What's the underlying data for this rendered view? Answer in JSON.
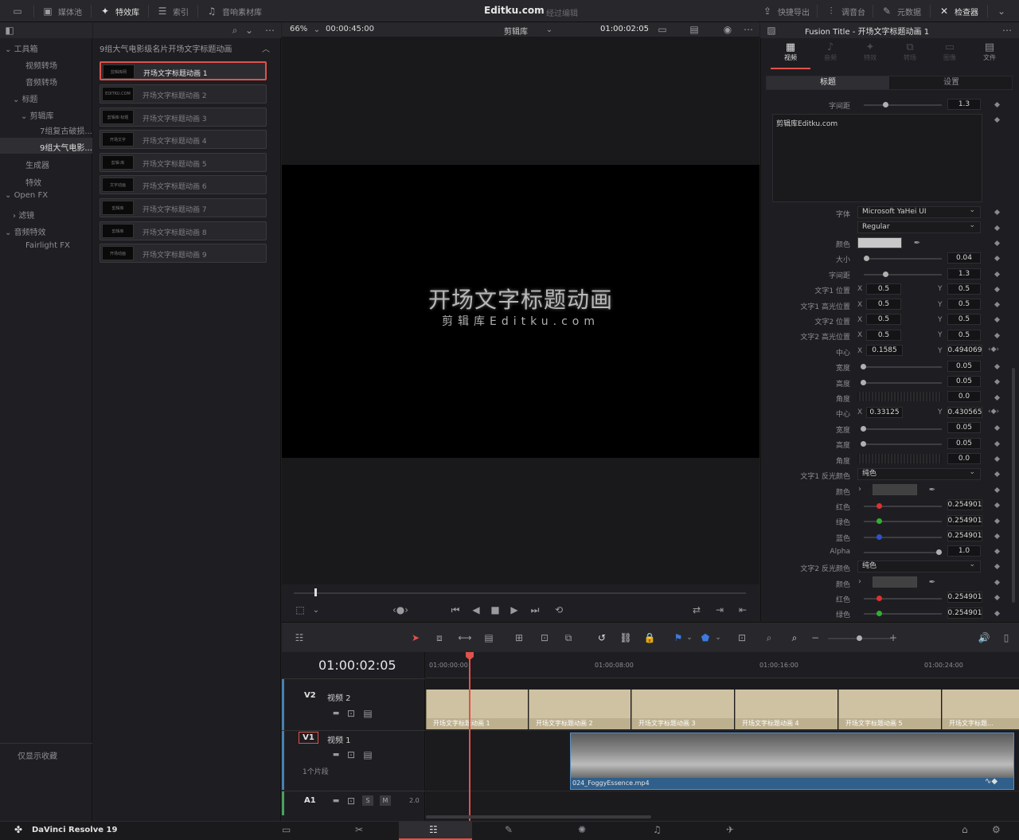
{
  "topbar": {
    "media_pool": "媒体池",
    "effects": "特效库",
    "index": "索引",
    "sound_library": "音响素材库",
    "app_title": "Editku.com",
    "app_sub": "经过编辑",
    "quick_export": "快捷导出",
    "mixer": "调音台",
    "metadata": "元数据",
    "inspector": "检查器"
  },
  "toolbox": {
    "items": [
      "工具箱",
      "视频转场",
      "音频转场",
      "标题",
      "剪辑库",
      "7组复古破损...",
      "9组大气电影...",
      "生成器",
      "特效",
      "Open FX",
      "滤镜",
      "音频特效",
      "Fairlight FX"
    ],
    "favorites": "仅显示收藏"
  },
  "library": {
    "header": "9组大气电影级名片开场文字标题动画",
    "cards": [
      "开场文字标题动画 1",
      "开场文字标题动画 2",
      "开场文字标题动画 3",
      "开场文字标题动画 4",
      "开场文字标题动画 5",
      "开场文字标题动画 6",
      "开场文字标题动画 7",
      "开场文字标题动画 8",
      "开场文字标题动画 9"
    ],
    "thumbs": [
      "剪辑库网",
      "EDITKU.COM",
      "剪辑库·标题",
      "开场文字",
      "剪辑·库",
      "文字动画",
      "剪辑库",
      "剪辑库",
      "开场动画"
    ]
  },
  "viewer": {
    "zoom": "66%",
    "duration": "00:00:45:00",
    "clip_name": "剪辑库",
    "timecode": "01:00:02:05",
    "title_main": "开场文字标题动画",
    "title_sub": "剪辑库Editku.com"
  },
  "inspector": {
    "title": "Fusion Title - 开场文字标题动画 1",
    "tabs": [
      "视频",
      "音频",
      "特效",
      "转场",
      "图像",
      "文件"
    ],
    "subtabs": [
      "标题",
      "设置"
    ],
    "text_content": "剪辑库Editku.com",
    "rows": [
      {
        "label": "字间距",
        "value": "1.3"
      },
      {
        "label": "字体",
        "value": "Microsoft YaHei UI"
      },
      {
        "label": "",
        "value": "Regular"
      },
      {
        "label": "颜色"
      },
      {
        "label": "大小",
        "value": "0.04"
      },
      {
        "label": "字间距",
        "value": "1.3"
      },
      {
        "label": "文字1 位置",
        "x": "0.5",
        "y": "0.5"
      },
      {
        "label": "文字1 高光位置",
        "x": "0.5",
        "y": "0.5"
      },
      {
        "label": "文字2 位置",
        "x": "0.5",
        "y": "0.5"
      },
      {
        "label": "文字2 高光位置",
        "x": "0.5",
        "y": "0.5"
      },
      {
        "label": "中心",
        "x": "0.1585",
        "y": "0.494069"
      },
      {
        "label": "宽度",
        "value": "0.05"
      },
      {
        "label": "高度",
        "value": "0.05"
      },
      {
        "label": "角度",
        "value": "0.0"
      },
      {
        "label": "中心",
        "x": "0.33125",
        "y": "0.430565"
      },
      {
        "label": "宽度",
        "value": "0.05"
      },
      {
        "label": "高度",
        "value": "0.05"
      },
      {
        "label": "角度",
        "value": "0.0"
      },
      {
        "label": "文字1 反光颜色",
        "value": "纯色"
      },
      {
        "label": "颜色"
      },
      {
        "label": "红色",
        "value": "0.254901"
      },
      {
        "label": "绿色",
        "value": "0.254901"
      },
      {
        "label": "蓝色",
        "value": "0.254901"
      },
      {
        "label": "Alpha",
        "value": "1.0"
      },
      {
        "label": "文字2 反光颜色",
        "value": "纯色"
      },
      {
        "label": "颜色"
      },
      {
        "label": "红色",
        "value": "0.254901"
      },
      {
        "label": "绿色",
        "value": "0.254901"
      }
    ],
    "x_label": "X",
    "y_label": "Y"
  },
  "timeline": {
    "timecode": "01:00:02:05",
    "ruler": [
      "01:00:00:00",
      "01:00:08:00",
      "01:00:16:00",
      "01:00:24:00"
    ],
    "v2_name": "视频 2",
    "v1_name": "视频 1",
    "v2": "V2",
    "v1": "V1",
    "a1": "A1",
    "a1_level": "2.0",
    "clip_count": "1个片段",
    "clips": [
      "开场文字标题动画 1",
      "开场文字标题动画 2",
      "开场文字标题动画 3",
      "开场文字标题动画 4",
      "开场文字标题动画 5",
      "开场文字标题..."
    ],
    "video_clip": "024_FoggyEssence.mp4"
  },
  "bottombar": {
    "app_name": "DaVinci Resolve 19"
  }
}
